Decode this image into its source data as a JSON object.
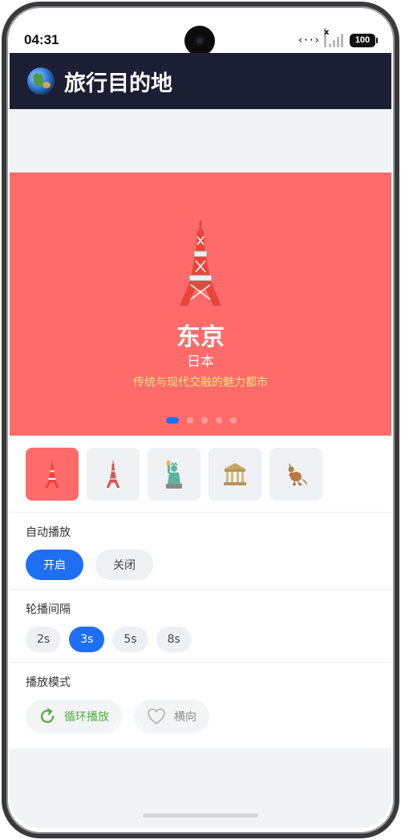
{
  "status_bar": {
    "time": "04:31",
    "battery": "100"
  },
  "header": {
    "title": "旅行目的地",
    "logo_icon": "globe-icon"
  },
  "carousel": {
    "slide": {
      "icon": "tokyo-tower-icon",
      "city": "东京",
      "country": "日本",
      "description": "传统与现代交融的魅力都市"
    },
    "page_count": 5,
    "active_index": 0,
    "bg_color": "#ff6b6b",
    "dot_active_color": "#1f6ff5"
  },
  "thumbnails": [
    {
      "icon": "tokyo-tower-icon",
      "active": true
    },
    {
      "icon": "eiffel-tower-icon",
      "active": false
    },
    {
      "icon": "statue-of-liberty-icon",
      "active": false
    },
    {
      "icon": "classical-building-icon",
      "active": false
    },
    {
      "icon": "kangaroo-icon",
      "active": false
    }
  ],
  "autoplay": {
    "label": "自动播放",
    "on": "开启",
    "off": "关闭",
    "selected": "开启"
  },
  "interval": {
    "label": "轮播间隔",
    "options": [
      "2s",
      "3s",
      "5s",
      "8s"
    ],
    "selected": "3s"
  },
  "mode": {
    "label": "播放模式",
    "loop": "循环播放",
    "horizontal": "横向",
    "loop_icon": "refresh-icon",
    "horizontal_icon": "heart-icon"
  },
  "accent_color": "#1f6ff5"
}
